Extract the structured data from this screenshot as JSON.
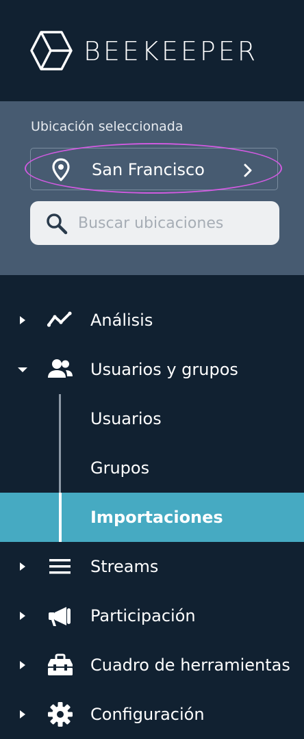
{
  "brand": {
    "logo_icon": "hexagon-cube-icon",
    "name": "BEEKEEPER"
  },
  "location": {
    "caption": "Ubicación seleccionada",
    "selected": "San Francisco",
    "pin_icon": "map-pin-icon",
    "chevron_icon": "chevron-right-icon",
    "highlight_color": "#d05be0"
  },
  "search": {
    "icon": "search-icon",
    "placeholder": "Buscar ubicaciones",
    "value": ""
  },
  "nav": {
    "items": [
      {
        "label": "Análisis",
        "icon": "trend-line-icon",
        "expanded": false
      },
      {
        "label": "Usuarios y grupos",
        "icon": "users-icon",
        "expanded": true
      },
      {
        "label": "Streams",
        "icon": "hamburger-lines-icon",
        "expanded": false
      },
      {
        "label": "Participación",
        "icon": "megaphone-icon",
        "expanded": false
      },
      {
        "label": "Cuadro de herramientas",
        "icon": "toolbox-icon",
        "expanded": false
      },
      {
        "label": "Configuración",
        "icon": "gear-icon",
        "expanded": false
      }
    ],
    "subitems": [
      {
        "label": "Usuarios",
        "active": false
      },
      {
        "label": "Grupos",
        "active": false
      },
      {
        "label": "Importaciones",
        "active": true
      }
    ]
  },
  "colors": {
    "sidebar_bg": "#112131",
    "location_panel_bg": "#475b71",
    "active_item_bg": "#46aac2"
  }
}
